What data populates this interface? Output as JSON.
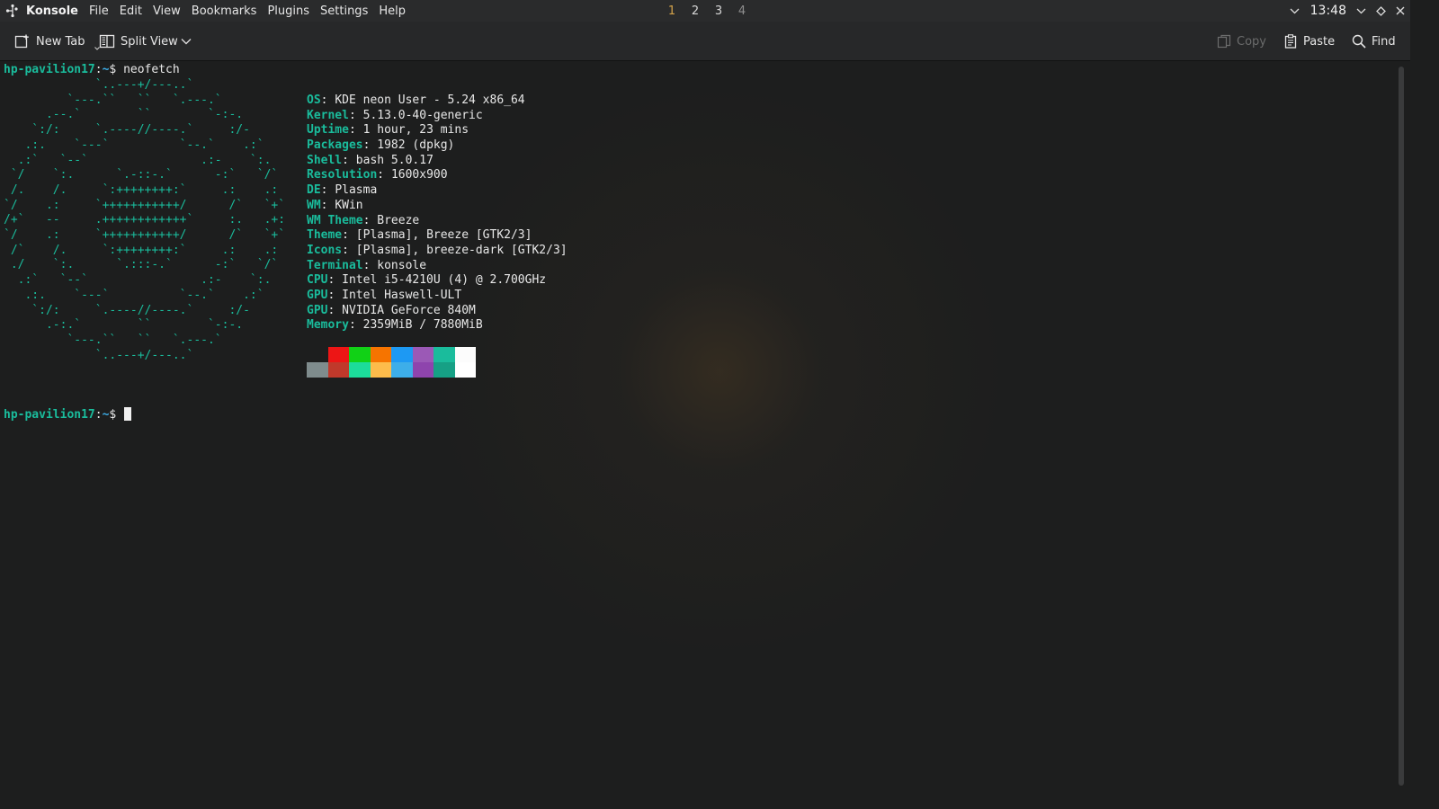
{
  "menubar": {
    "app_name": "Konsole",
    "menus": [
      "File",
      "Edit",
      "View",
      "Bookmarks",
      "Plugins",
      "Settings",
      "Help"
    ],
    "desktops": [
      "1",
      "2",
      "3",
      "4"
    ],
    "active_desktop": "1",
    "clock": "13:48",
    "tray_icons": [
      "chevron-down-icon",
      "chevron-down-icon",
      "diamond-icon",
      "close-icon"
    ]
  },
  "toolbar": {
    "new_tab": "New Tab",
    "split_view": "Split View",
    "copy": "Copy",
    "paste": "Paste",
    "find": "Find"
  },
  "terminal": {
    "prompt_host": "hp-pavilion17",
    "prompt_path": "~",
    "prompt_symbol": "$",
    "command": "neofetch",
    "logo": [
      "             `..---+/---..`",
      "         `---.``   ``   `.---.`",
      "      .--.`        ``        `-:-.",
      "    `:/:     `.----//----.`     :/-",
      "   .:.    `---`          `--.`    .:`",
      "  .:`   `--`                .:-    `:.",
      " `/    `:.      `.-::-.`      -:`   `/`",
      " /.    /.     `:++++++++:`     .:    .:",
      "`/    .:     `+++++++++++/      /`   `+`",
      "/+`   --     .++++++++++++`     :.   .+:",
      "`/    .:     `+++++++++++/      /`   `+`",
      " /`    /.     `:++++++++:`     .:    .:",
      " ./    `:.      `.:::-.`      -:`   `/`",
      "  .:`   `--`                .:-    `:.",
      "   .:.    `---`          `--.`    .:`",
      "    `:/:     `.----//----.`     :/-",
      "      .-:.`        ``        `-:-.",
      "         `---.``   ``   `.---.`",
      "             `..---+/---..`"
    ],
    "info": [
      {
        "key": "OS",
        "value": "KDE neon User - 5.24 x86_64"
      },
      {
        "key": "Kernel",
        "value": "5.13.0-40-generic"
      },
      {
        "key": "Uptime",
        "value": "1 hour, 23 mins"
      },
      {
        "key": "Packages",
        "value": "1982 (dpkg)"
      },
      {
        "key": "Shell",
        "value": "bash 5.0.17"
      },
      {
        "key": "Resolution",
        "value": "1600x900"
      },
      {
        "key": "DE",
        "value": "Plasma"
      },
      {
        "key": "WM",
        "value": "KWin"
      },
      {
        "key": "WM Theme",
        "value": "Breeze"
      },
      {
        "key": "Theme",
        "value": "[Plasma], Breeze [GTK2/3]"
      },
      {
        "key": "Icons",
        "value": "[Plasma], breeze-dark [GTK2/3]"
      },
      {
        "key": "Terminal",
        "value": "konsole"
      },
      {
        "key": "CPU",
        "value": "Intel i5-4210U (4) @ 2.700GHz"
      },
      {
        "key": "GPU",
        "value": "Intel Haswell-ULT"
      },
      {
        "key": "GPU",
        "value": "NVIDIA GeForce 840M"
      },
      {
        "key": "Memory",
        "value": "2359MiB / 7880MiB"
      }
    ],
    "palette_row1": [
      "#1d1e1e",
      "#ed1515",
      "#11d116",
      "#f67400",
      "#1d99f3",
      "#9b59b6",
      "#1abc9c",
      "#fcfcfc"
    ],
    "palette_row2": [
      "#7f8c8d",
      "#c0392b",
      "#1cdc9a",
      "#fdbc4b",
      "#3daee9",
      "#8e44ad",
      "#16a085",
      "#ffffff"
    ]
  },
  "colors": {
    "accent": "#1abc9c",
    "path": "#3daee9",
    "active_desktop": "#d4a34a"
  }
}
